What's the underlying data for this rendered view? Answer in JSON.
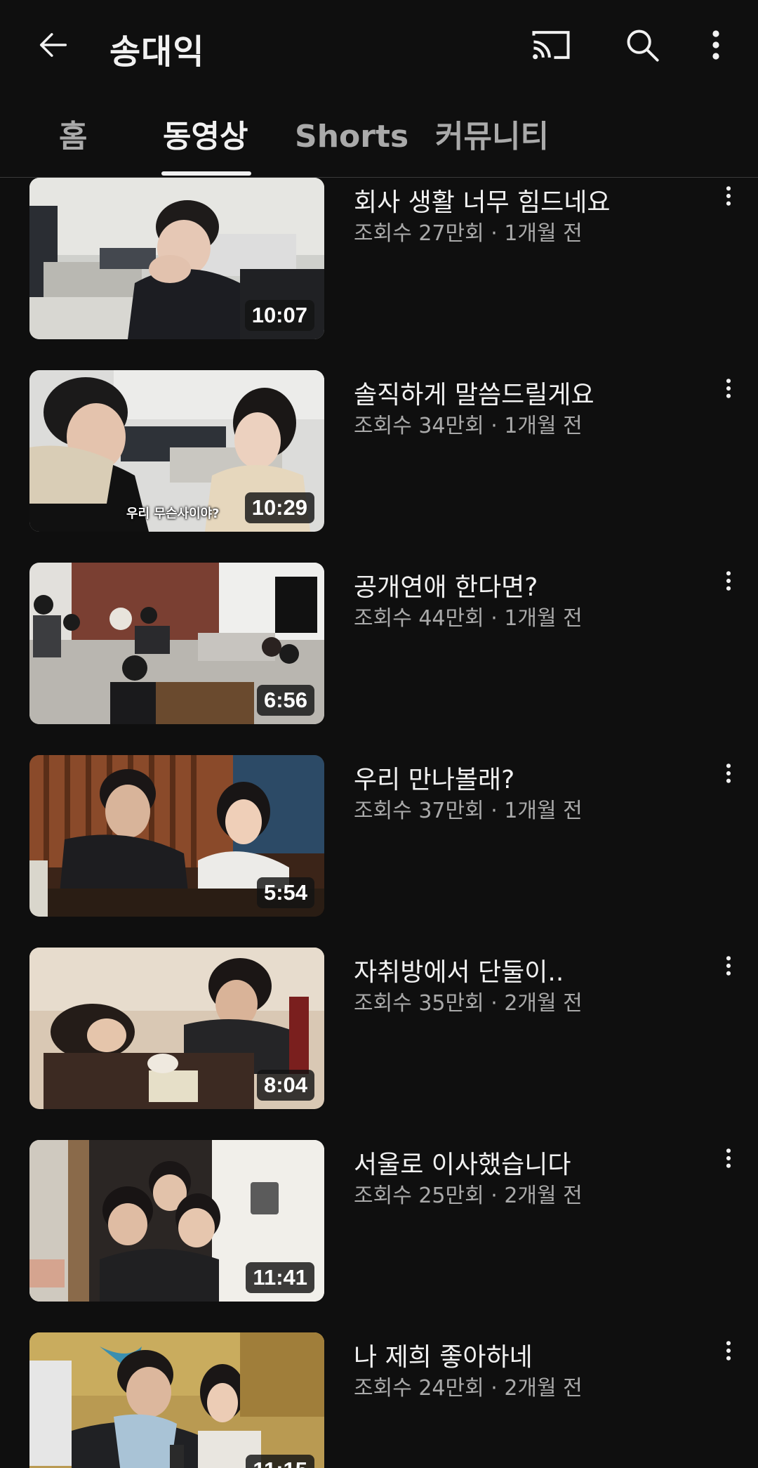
{
  "header": {
    "channel_name": "송대익",
    "icons": [
      "back-arrow-icon",
      "cast-icon",
      "search-icon",
      "more-vertical-icon"
    ]
  },
  "tabs": [
    {
      "label": "홈",
      "active": false
    },
    {
      "label": "동영상",
      "active": true
    },
    {
      "label": "Shorts",
      "active": false
    },
    {
      "label": "커뮤니티",
      "active": false
    }
  ],
  "videos": [
    {
      "title": "회사 생활 너무 힘드네요",
      "meta": "조회수 27만회 · 1개월 전",
      "duration": "10:07",
      "caption": ""
    },
    {
      "title": "솔직하게 말씀드릴게요",
      "meta": "조회수 34만회 · 1개월 전",
      "duration": "10:29",
      "caption": "우리 무슨사이야?"
    },
    {
      "title": "공개연애 한다면?",
      "meta": "조회수 44만회 · 1개월 전",
      "duration": "6:56",
      "caption": ""
    },
    {
      "title": "우리 만나볼래?",
      "meta": "조회수 37만회 · 1개월 전",
      "duration": "5:54",
      "caption": ""
    },
    {
      "title": "자취방에서 단둘이..",
      "meta": "조회수 35만회 · 2개월 전",
      "duration": "8:04",
      "caption": ""
    },
    {
      "title": "서울로 이사했습니다",
      "meta": "조회수 25만회 · 2개월 전",
      "duration": "11:41",
      "caption": ""
    },
    {
      "title": "나 제희 좋아하네",
      "meta": "조회수 24만회 · 2개월 전",
      "duration": "11:15",
      "caption": ""
    }
  ],
  "colors": {
    "background": "#0f0f0f",
    "text_primary": "#f1f1f1",
    "text_secondary": "#aaaaaa",
    "divider": "#3a3a3a"
  }
}
